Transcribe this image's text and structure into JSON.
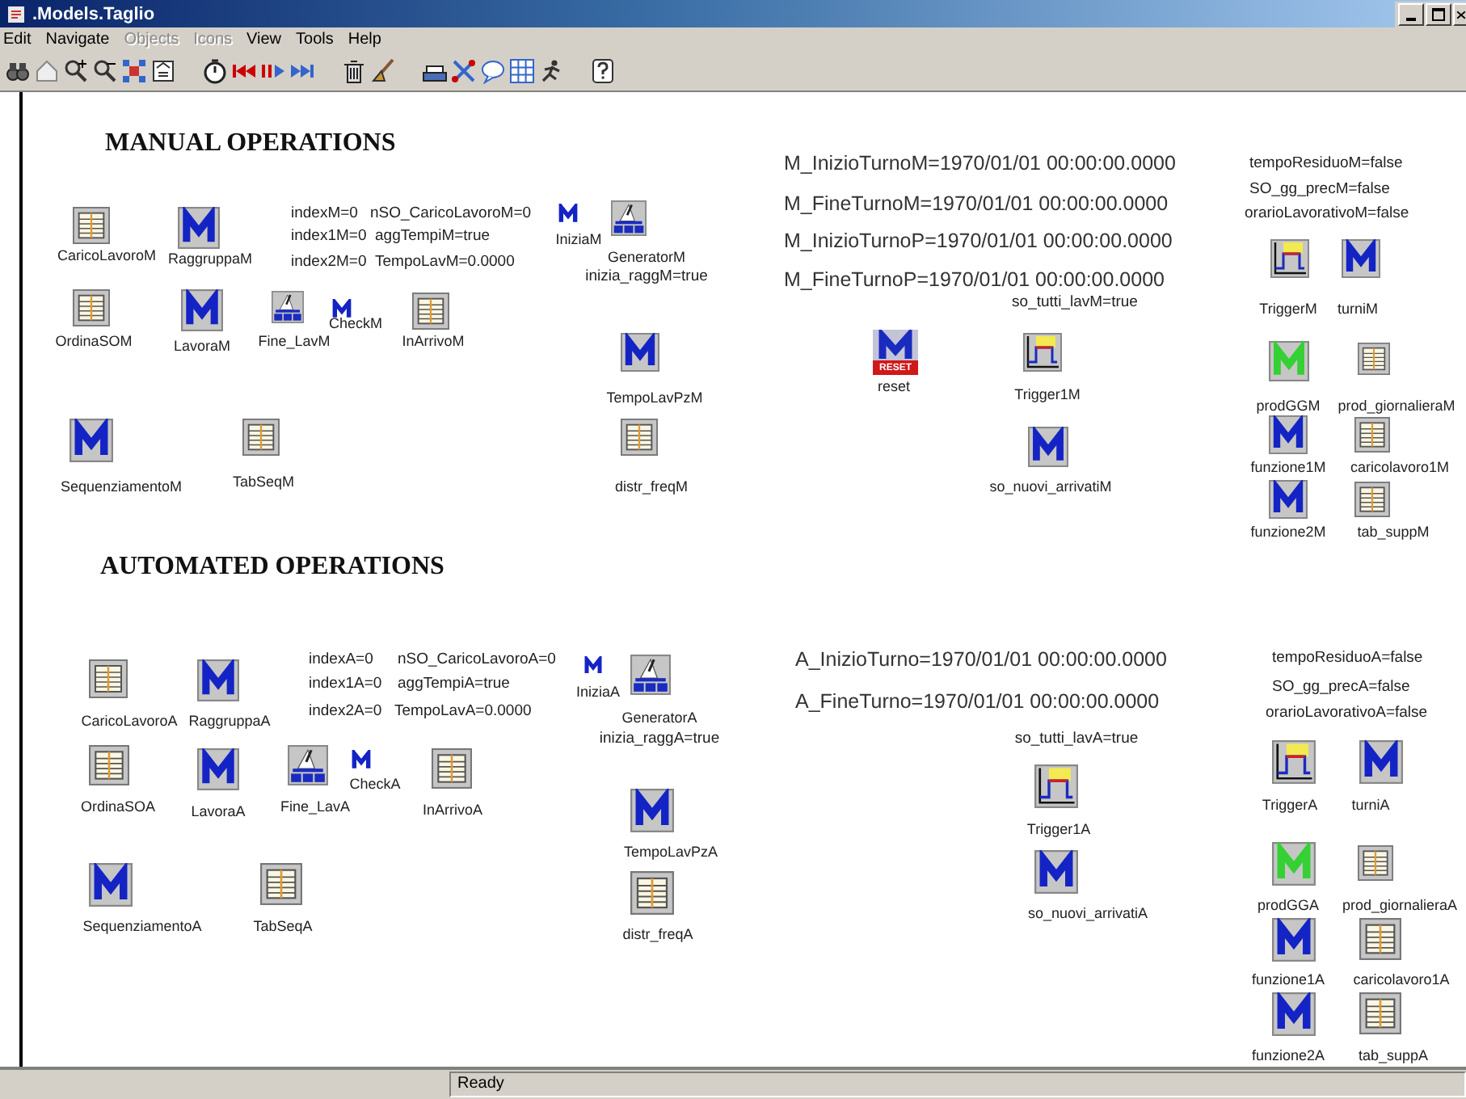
{
  "window": {
    "title": ".Models.Taglio"
  },
  "menu": [
    {
      "label": "Edit",
      "disabled": false
    },
    {
      "label": "Navigate",
      "disabled": false
    },
    {
      "label": "Objects",
      "disabled": true
    },
    {
      "label": "Icons",
      "disabled": true
    },
    {
      "label": "View",
      "disabled": false
    },
    {
      "label": "Tools",
      "disabled": false
    },
    {
      "label": "Help",
      "disabled": false
    }
  ],
  "canvas": {
    "items": [
      {
        "kind": "heading",
        "label": "MANUAL OPERATIONS"
      },
      {
        "kind": "table",
        "label": "CaricoLavoroM"
      },
      {
        "kind": "function",
        "label": "RaggruppaM"
      },
      {
        "kind": "value",
        "label": "indexM=0"
      },
      {
        "kind": "value",
        "label": "nSO_CaricoLavoroM=0"
      },
      {
        "kind": "value",
        "label": "index1M=0"
      },
      {
        "kind": "value",
        "label": "aggTempiM=true"
      },
      {
        "kind": "value",
        "label": "index2M=0"
      },
      {
        "kind": "value",
        "label": "TempoLavM=0.0000"
      },
      {
        "kind": "event",
        "label": "IniziaM"
      },
      {
        "kind": "generator",
        "label": "GeneratorM"
      },
      {
        "kind": "value",
        "label": "inizia_raggM=true"
      },
      {
        "kind": "table",
        "label": "OrdinaSOM"
      },
      {
        "kind": "function",
        "label": "LavoraM"
      },
      {
        "kind": "generator",
        "label": "Fine_LavM"
      },
      {
        "kind": "event",
        "label": "CheckM"
      },
      {
        "kind": "table",
        "label": "InArrivoM"
      },
      {
        "kind": "function",
        "label": "TempoLavPzM"
      },
      {
        "kind": "function",
        "label": "SequenziamentoM"
      },
      {
        "kind": "table",
        "label": "TabSeqM"
      },
      {
        "kind": "table",
        "label": "distr_freqM"
      },
      {
        "kind": "clock",
        "label": "M_InizioTurnoM=1970/01/01 00:00:00.0000"
      },
      {
        "kind": "clock",
        "label": "M_FineTurnoM=1970/01/01 00:00:00.0000"
      },
      {
        "kind": "clock",
        "label": "M_InizioTurnoP=1970/01/01 00:00:00.0000"
      },
      {
        "kind": "clock",
        "label": "M_FineTurnoP=1970/01/01 00:00:00.0000"
      },
      {
        "kind": "value",
        "label": "tempoResiduoM=false"
      },
      {
        "kind": "value",
        "label": "SO_gg_precM=false"
      },
      {
        "kind": "value",
        "label": "orarioLavorativoM=false"
      },
      {
        "kind": "trigger",
        "label": "TriggerM"
      },
      {
        "kind": "function",
        "label": "turniM"
      },
      {
        "kind": "value",
        "label": "so_tutti_lavM=true"
      },
      {
        "kind": "reset",
        "label": "reset",
        "badge": "RESET"
      },
      {
        "kind": "trigger",
        "label": "Trigger1M"
      },
      {
        "kind": "function",
        "label": "so_nuovi_arrivatiM"
      },
      {
        "kind": "statistic",
        "label": "prodGGM"
      },
      {
        "kind": "table",
        "label": "prod_giornalieraM"
      },
      {
        "kind": "function",
        "label": "funzione1M"
      },
      {
        "kind": "table",
        "label": "caricolavoro1M"
      },
      {
        "kind": "function",
        "label": "funzione2M"
      },
      {
        "kind": "table",
        "label": "tab_suppM"
      },
      {
        "kind": "heading",
        "label": "AUTOMATED OPERATIONS"
      },
      {
        "kind": "table",
        "label": "CaricoLavoroA"
      },
      {
        "kind": "function",
        "label": "RaggruppaA"
      },
      {
        "kind": "value",
        "label": "indexA=0"
      },
      {
        "kind": "value",
        "label": "nSO_CaricoLavoroA=0"
      },
      {
        "kind": "value",
        "label": "index1A=0"
      },
      {
        "kind": "value",
        "label": "aggTempiA=true"
      },
      {
        "kind": "value",
        "label": "index2A=0"
      },
      {
        "kind": "value",
        "label": "TempoLavA=0.0000"
      },
      {
        "kind": "event",
        "label": "IniziaA"
      },
      {
        "kind": "generator",
        "label": "GeneratorA"
      },
      {
        "kind": "value",
        "label": "inizia_raggA=true"
      },
      {
        "kind": "table",
        "label": "OrdinaSOA"
      },
      {
        "kind": "function",
        "label": "LavoraA"
      },
      {
        "kind": "generator",
        "label": "Fine_LavA"
      },
      {
        "kind": "event",
        "label": "CheckA"
      },
      {
        "kind": "table",
        "label": "InArrivoA"
      },
      {
        "kind": "function",
        "label": "TempoLavPzA"
      },
      {
        "kind": "function",
        "label": "SequenziamentoA"
      },
      {
        "kind": "table",
        "label": "TabSeqA"
      },
      {
        "kind": "table",
        "label": "distr_freqA"
      },
      {
        "kind": "clock",
        "label": "A_InizioTurno=1970/01/01 00:00:00.0000"
      },
      {
        "kind": "clock",
        "label": "A_FineTurno=1970/01/01 00:00:00.0000"
      },
      {
        "kind": "value",
        "label": "tempoResiduoA=false"
      },
      {
        "kind": "value",
        "label": "SO_gg_precA=false"
      },
      {
        "kind": "value",
        "label": "orarioLavorativoA=false"
      },
      {
        "kind": "value",
        "label": "so_tutti_lavA=true"
      },
      {
        "kind": "trigger",
        "label": "Trigger1A"
      },
      {
        "kind": "function",
        "label": "so_nuovi_arrivatiA"
      },
      {
        "kind": "trigger",
        "label": "TriggerA"
      },
      {
        "kind": "function",
        "label": "turniA"
      },
      {
        "kind": "statistic",
        "label": "prodGGA"
      },
      {
        "kind": "table",
        "label": "prod_giornalieraA"
      },
      {
        "kind": "function",
        "label": "funzione1A"
      },
      {
        "kind": "table",
        "label": "caricolavoro1A"
      },
      {
        "kind": "function",
        "label": "funzione2A"
      },
      {
        "kind": "table",
        "label": "tab_suppA"
      }
    ]
  },
  "status_bar": {
    "text": "Ready"
  }
}
